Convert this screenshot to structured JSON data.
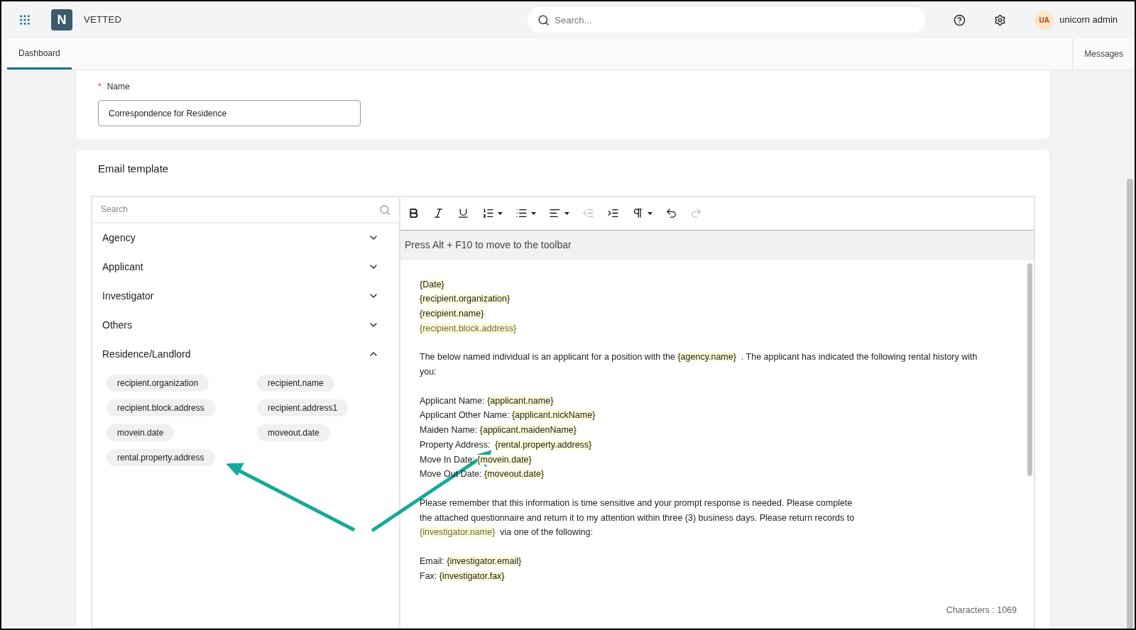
{
  "header": {
    "brand": "VETTED",
    "logo_letter": "N",
    "search": {
      "placeholder": "Search..."
    },
    "user": {
      "initials": "UA",
      "name": "unicorn admin"
    }
  },
  "tabs": [
    {
      "label": "Dashboard",
      "selected": true
    },
    {
      "label": "Messages",
      "selected": false
    }
  ],
  "name_field": {
    "label": "Name",
    "required": true,
    "required_mark": "*",
    "value": "Correspondence for Residence"
  },
  "email_template": {
    "title": "Email template",
    "variables": {
      "search": {
        "placeholder": "Search"
      },
      "sections": [
        {
          "label": "Agency",
          "expanded": false
        },
        {
          "label": "Applicant",
          "expanded": false
        },
        {
          "label": "Investigator",
          "expanded": false
        },
        {
          "label": "Others",
          "expanded": false
        },
        {
          "label": "Residence/Landlord",
          "expanded": true,
          "chips": [
            "recipient.organization",
            "recipient.name",
            "recipient.block.address",
            "recipient.address1",
            "movein.date",
            "moveout.date",
            "rental.property.address"
          ]
        }
      ]
    },
    "toolbar": [
      {
        "kind": "bold",
        "disabled": false,
        "dropdown": false
      },
      {
        "kind": "italic",
        "disabled": false,
        "dropdown": false
      },
      {
        "kind": "underline",
        "disabled": false,
        "dropdown": false
      },
      {
        "kind": "numbered-list",
        "disabled": false,
        "dropdown": true
      },
      {
        "kind": "bullet-list",
        "disabled": false,
        "dropdown": true
      },
      {
        "kind": "align",
        "disabled": false,
        "dropdown": true
      },
      {
        "kind": "outdent",
        "disabled": true,
        "dropdown": false
      },
      {
        "kind": "indent",
        "disabled": false,
        "dropdown": false
      },
      {
        "kind": "paragraph",
        "disabled": false,
        "dropdown": true
      },
      {
        "kind": "undo",
        "disabled": false,
        "dropdown": false
      },
      {
        "kind": "redo",
        "disabled": true,
        "dropdown": false
      }
    ],
    "hint": "Press Alt + F10 to move to the toolbar",
    "paragraphs": [
      [
        [
          {
            "kind": "tag",
            "text": "{Date}"
          }
        ],
        [
          {
            "kind": "tag",
            "text": "{recipient.organization}"
          }
        ],
        [
          {
            "kind": "tag",
            "text": "{recipient.name}"
          }
        ],
        [
          {
            "kind": "tag_muted",
            "text": "{recipient.block.address}"
          }
        ]
      ],
      [
        [
          {
            "kind": "text",
            "text": "The below named individual is an applicant for a position with the "
          },
          {
            "kind": "tag",
            "text": "{agency.name}"
          },
          {
            "kind": "text",
            "text": "  . The applicant has indicated the following rental history with"
          }
        ],
        [
          {
            "kind": "text",
            "text": "you:"
          }
        ]
      ],
      [
        [
          {
            "kind": "text",
            "text": "Applicant Name: "
          },
          {
            "kind": "tag",
            "text": "{applicant.name}"
          }
        ],
        [
          {
            "kind": "text",
            "text": "Applicant Other Name: "
          },
          {
            "kind": "tag",
            "text": "{applicant.nickName}"
          }
        ],
        [
          {
            "kind": "text",
            "text": "Maiden Name: "
          },
          {
            "kind": "tag",
            "text": "{applicant.maidenName}"
          }
        ],
        [
          {
            "kind": "text",
            "text": "Property Address:  "
          },
          {
            "kind": "tag",
            "text": "{rental.property.address}"
          }
        ],
        [
          {
            "kind": "text",
            "text": "Move In Date: "
          },
          {
            "kind": "tag",
            "text": "{movein.date}"
          }
        ],
        [
          {
            "kind": "text",
            "text": "Move Out Date: "
          },
          {
            "kind": "tag",
            "text": "{moveout.date}"
          }
        ]
      ],
      [
        [
          {
            "kind": "text",
            "text": "Please remember that this information is time sensitive and your prompt response is needed. Please complete"
          }
        ],
        [
          {
            "kind": "text",
            "text": "the attached questionnaire and return it to my attention within three (3) business days. Please return records to"
          }
        ],
        [
          {
            "kind": "tag_muted",
            "text": "{investigator.name}"
          },
          {
            "kind": "text",
            "text": "  via one of the following:"
          }
        ]
      ],
      [
        [
          {
            "kind": "text",
            "text": "Email: "
          },
          {
            "kind": "tag",
            "text": "{investigator.email}"
          }
        ],
        [
          {
            "kind": "text",
            "text": "Fax: "
          },
          {
            "kind": "tag",
            "text": "{investigator.fax}"
          }
        ]
      ]
    ],
    "char_count": "Characters : 1069"
  }
}
